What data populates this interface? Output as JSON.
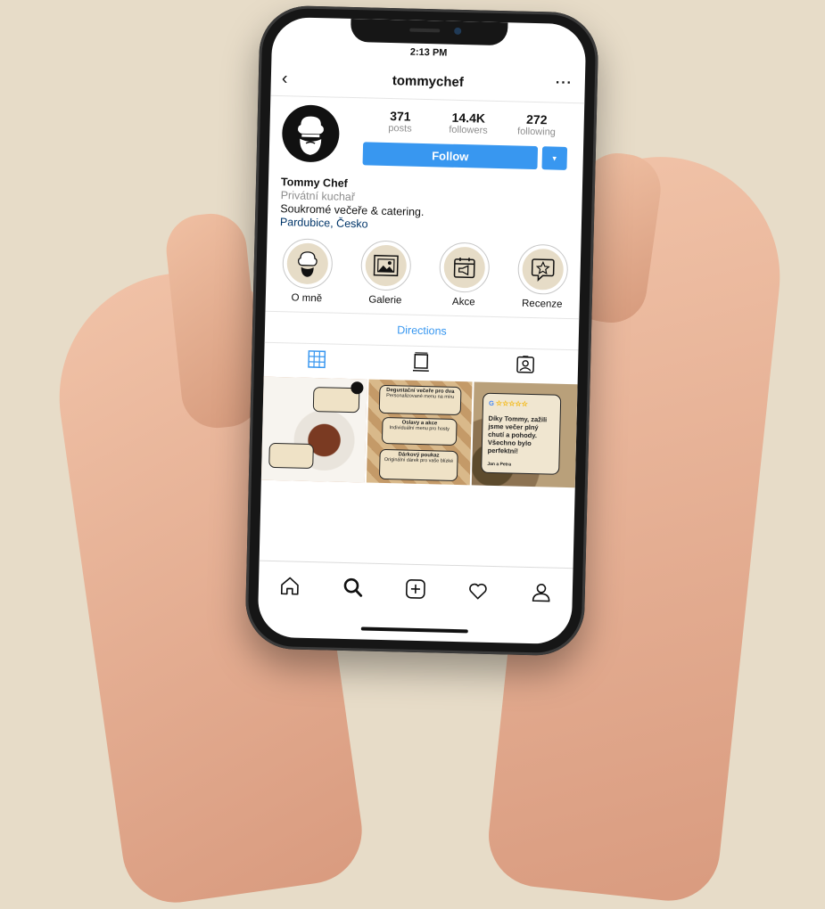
{
  "status": {
    "time": "2:13 PM"
  },
  "header": {
    "username": "tommychef",
    "back_glyph": "‹",
    "more_glyph": "···"
  },
  "profile": {
    "stats": [
      {
        "value": "371",
        "label": "posts"
      },
      {
        "value": "14.4K",
        "label": "followers"
      },
      {
        "value": "272",
        "label": "following"
      }
    ],
    "follow_label": "Follow",
    "dropdown_glyph": "▾",
    "name": "Tommy Chef",
    "category": "Privátní kuchař",
    "bio": "Soukromé večeře & catering.",
    "location": "Pardubice, Česko"
  },
  "highlights": [
    {
      "label": "O mně",
      "icon": "chef-icon"
    },
    {
      "label": "Galerie",
      "icon": "image-icon"
    },
    {
      "label": "Akce",
      "icon": "calendar-megaphone-icon"
    },
    {
      "label": "Recenze",
      "icon": "star-bubble-icon"
    }
  ],
  "directions_label": "Directions",
  "tabs": [
    "grid-icon",
    "feed-icon",
    "tagged-icon"
  ],
  "posts": {
    "p2_cards": [
      {
        "title": "Degustační večeře pro dva",
        "text": "Personalizované menu na míru"
      },
      {
        "title": "Oslavy a akce",
        "text": "Individuální menu pro hosty"
      },
      {
        "title": "Dárkový poukaz",
        "text": "Originální dárek pro vaše blízké"
      }
    ],
    "review": {
      "g": "G",
      "stars": "☆☆☆☆☆",
      "text": "Díky Tommy, zažili jsme večer plný chutí a pohody. Všechno bylo perfektní!",
      "signature": "Jan a Petra"
    }
  },
  "nav": [
    "home-icon",
    "search-icon",
    "add-post-icon",
    "heart-icon",
    "profile-icon"
  ],
  "colors": {
    "accent": "#3897f0",
    "highlight_bg": "#e6dcc7",
    "page_bg": "#e7dcc8"
  }
}
